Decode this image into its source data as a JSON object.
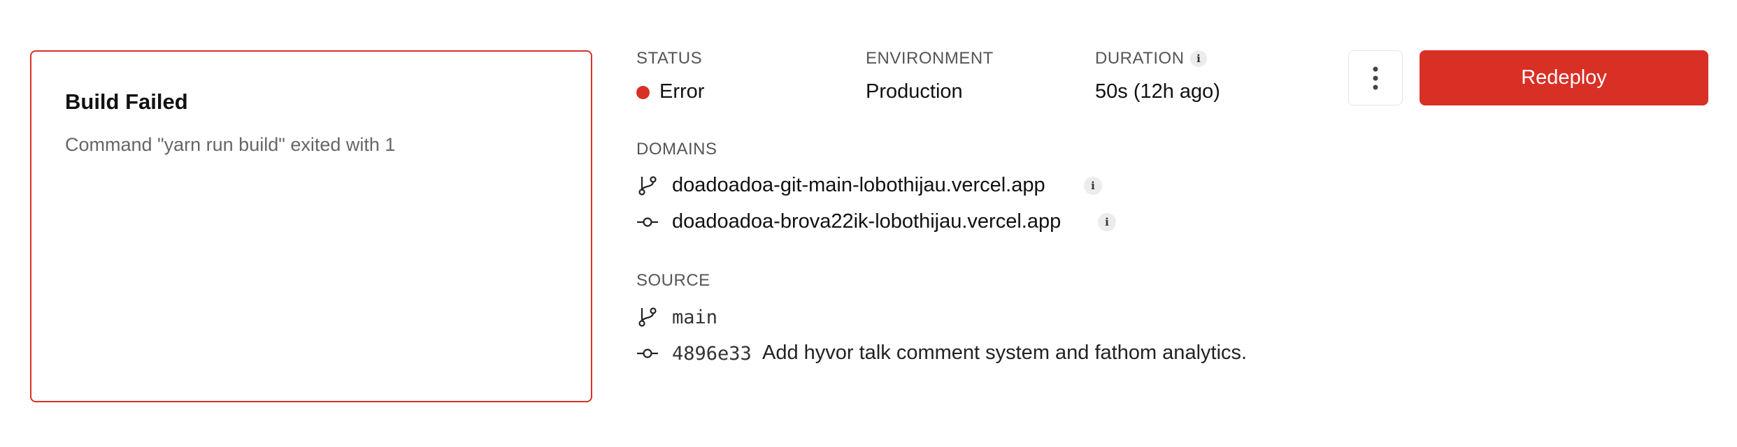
{
  "error_card": {
    "title": "Build Failed",
    "message": "Command \"yarn run build\" exited with 1"
  },
  "status": {
    "label": "STATUS",
    "value": "Error",
    "color": "#d93025"
  },
  "environment": {
    "label": "ENVIRONMENT",
    "value": "Production"
  },
  "duration": {
    "label": "DURATION",
    "value": "50s (12h ago)",
    "info_icon": "info-icon"
  },
  "actions": {
    "more_icon": "more-vertical-icon",
    "redeploy_label": "Redeploy",
    "accent_color": "#d93025"
  },
  "domains": {
    "label": "DOMAINS",
    "items": [
      {
        "url": "doadoadoa-git-main-lobothijau.vercel.app",
        "icon": "git-branch-icon",
        "info_icon": "info-icon"
      },
      {
        "url": "doadoadoa-brova22ik-lobothijau.vercel.app",
        "icon": "git-commit-icon",
        "info_icon": "info-icon"
      }
    ]
  },
  "source": {
    "label": "SOURCE",
    "branch": {
      "name": "main",
      "icon": "git-branch-icon"
    },
    "commit": {
      "hash": "4896e33",
      "message": "Add hyvor talk comment system and fathom analytics.",
      "icon": "git-commit-icon"
    }
  }
}
